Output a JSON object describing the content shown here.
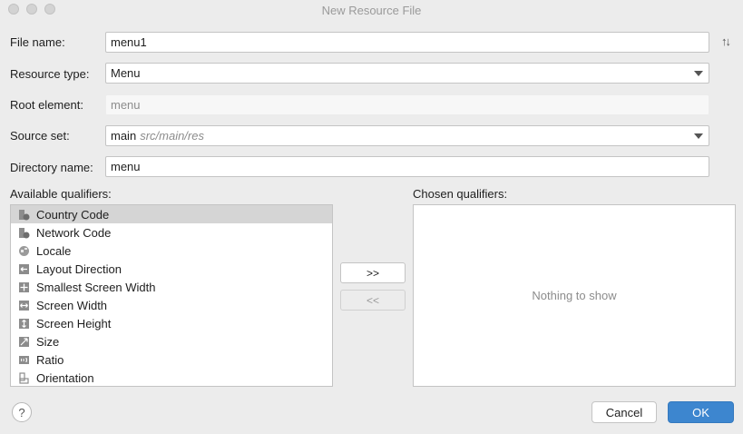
{
  "window": {
    "title": "New Resource File"
  },
  "form": {
    "file_name": {
      "label": "File name:",
      "value": "menu1"
    },
    "resource_type": {
      "label": "Resource type:",
      "value": "Menu"
    },
    "root_element": {
      "label": "Root element:",
      "value": "menu"
    },
    "source_set": {
      "label": "Source set:",
      "value": "main",
      "hint": "src/main/res"
    },
    "directory_name": {
      "label": "Directory name:",
      "value": "menu"
    }
  },
  "qualifiers": {
    "available_label": "Available qualifiers:",
    "chosen_label": "Chosen qualifiers:",
    "available": [
      {
        "label": "Country Code",
        "icon": "country-code-icon",
        "selected": true
      },
      {
        "label": "Network Code",
        "icon": "network-code-icon"
      },
      {
        "label": "Locale",
        "icon": "globe-icon"
      },
      {
        "label": "Layout Direction",
        "icon": "layout-direction-icon"
      },
      {
        "label": "Smallest Screen Width",
        "icon": "smallest-width-icon"
      },
      {
        "label": "Screen Width",
        "icon": "screen-width-icon"
      },
      {
        "label": "Screen Height",
        "icon": "screen-height-icon"
      },
      {
        "label": "Size",
        "icon": "size-icon"
      },
      {
        "label": "Ratio",
        "icon": "ratio-icon"
      },
      {
        "label": "Orientation",
        "icon": "orientation-icon"
      }
    ],
    "empty_text": "Nothing to show",
    "add_label": ">>",
    "remove_label": "<<"
  },
  "footer": {
    "help": "?",
    "cancel_label": "Cancel",
    "ok_label": "OK"
  },
  "colors": {
    "accent": "#3d86cf",
    "selected_row": "#d5d5d5"
  }
}
